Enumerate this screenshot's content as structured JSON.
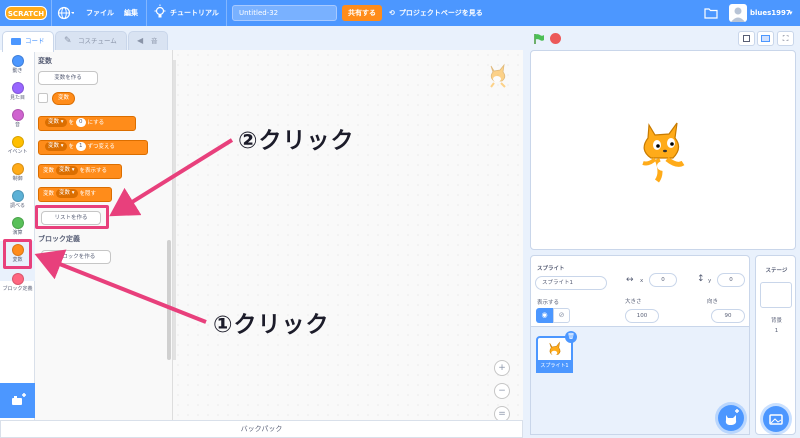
{
  "menubar": {
    "logo": "SCRATCH",
    "file": "ファイル",
    "edit": "編集",
    "tutorials": "チュートリアル",
    "project_title": "Untitled-32",
    "share": "共有する",
    "see_project_page": "プロジェクトページを見る",
    "username": "blues1997"
  },
  "tabs": [
    {
      "label": "コード"
    },
    {
      "label": "コスチューム"
    },
    {
      "label": "音"
    }
  ],
  "categories": [
    {
      "label": "動き",
      "color": "#4c97ff"
    },
    {
      "label": "見た目",
      "color": "#9966ff"
    },
    {
      "label": "音",
      "color": "#cf63cf"
    },
    {
      "label": "イベント",
      "color": "#ffbf00"
    },
    {
      "label": "制御",
      "color": "#ffab19"
    },
    {
      "label": "調べる",
      "color": "#5cb1d6"
    },
    {
      "label": "演算",
      "color": "#59c059"
    },
    {
      "label": "変数",
      "color": "#ff8c1a"
    },
    {
      "label": "ブロック定義",
      "color": "#ff6680"
    }
  ],
  "flyout": {
    "section_variables": "変数",
    "make_variable": "変数を作る",
    "var_name": "変数",
    "set_block": {
      "var": "変数",
      "to": "を",
      "value": "0",
      "suffix": "にする"
    },
    "change_block": {
      "var": "変数",
      "by": "を",
      "value": "1",
      "suffix": "ずつ変える"
    },
    "show_block": {
      "prefix": "変数",
      "var": "変数",
      "suffix": "を表示する"
    },
    "hide_block": {
      "prefix": "変数",
      "var": "変数",
      "suffix": "を隠す"
    },
    "make_list": "リストを作る",
    "section_my_blocks": "ブロック定義",
    "make_block": "ブロックを作る"
  },
  "backpack": "バックパック",
  "sprite_info": {
    "sprite_label": "スプライト",
    "sprite_name": "スプライト1",
    "x_label": "x",
    "x_value": "0",
    "y_label": "y",
    "y_value": "0",
    "show_label": "表示する",
    "size_label": "大きさ",
    "size_value": "100",
    "direction_label": "向き",
    "direction_value": "90"
  },
  "sprite_list": [
    {
      "name": "スプライト1"
    }
  ],
  "stage_panel": {
    "title": "ステージ",
    "backdrops_label": "背景",
    "backdrops_count": "1"
  },
  "annotations": {
    "step2": "②クリック",
    "step1": "①クリック"
  },
  "colors": {
    "menubar": "#4c97ff",
    "variables": "#ff8c1a",
    "highlight": "#e8407c"
  }
}
